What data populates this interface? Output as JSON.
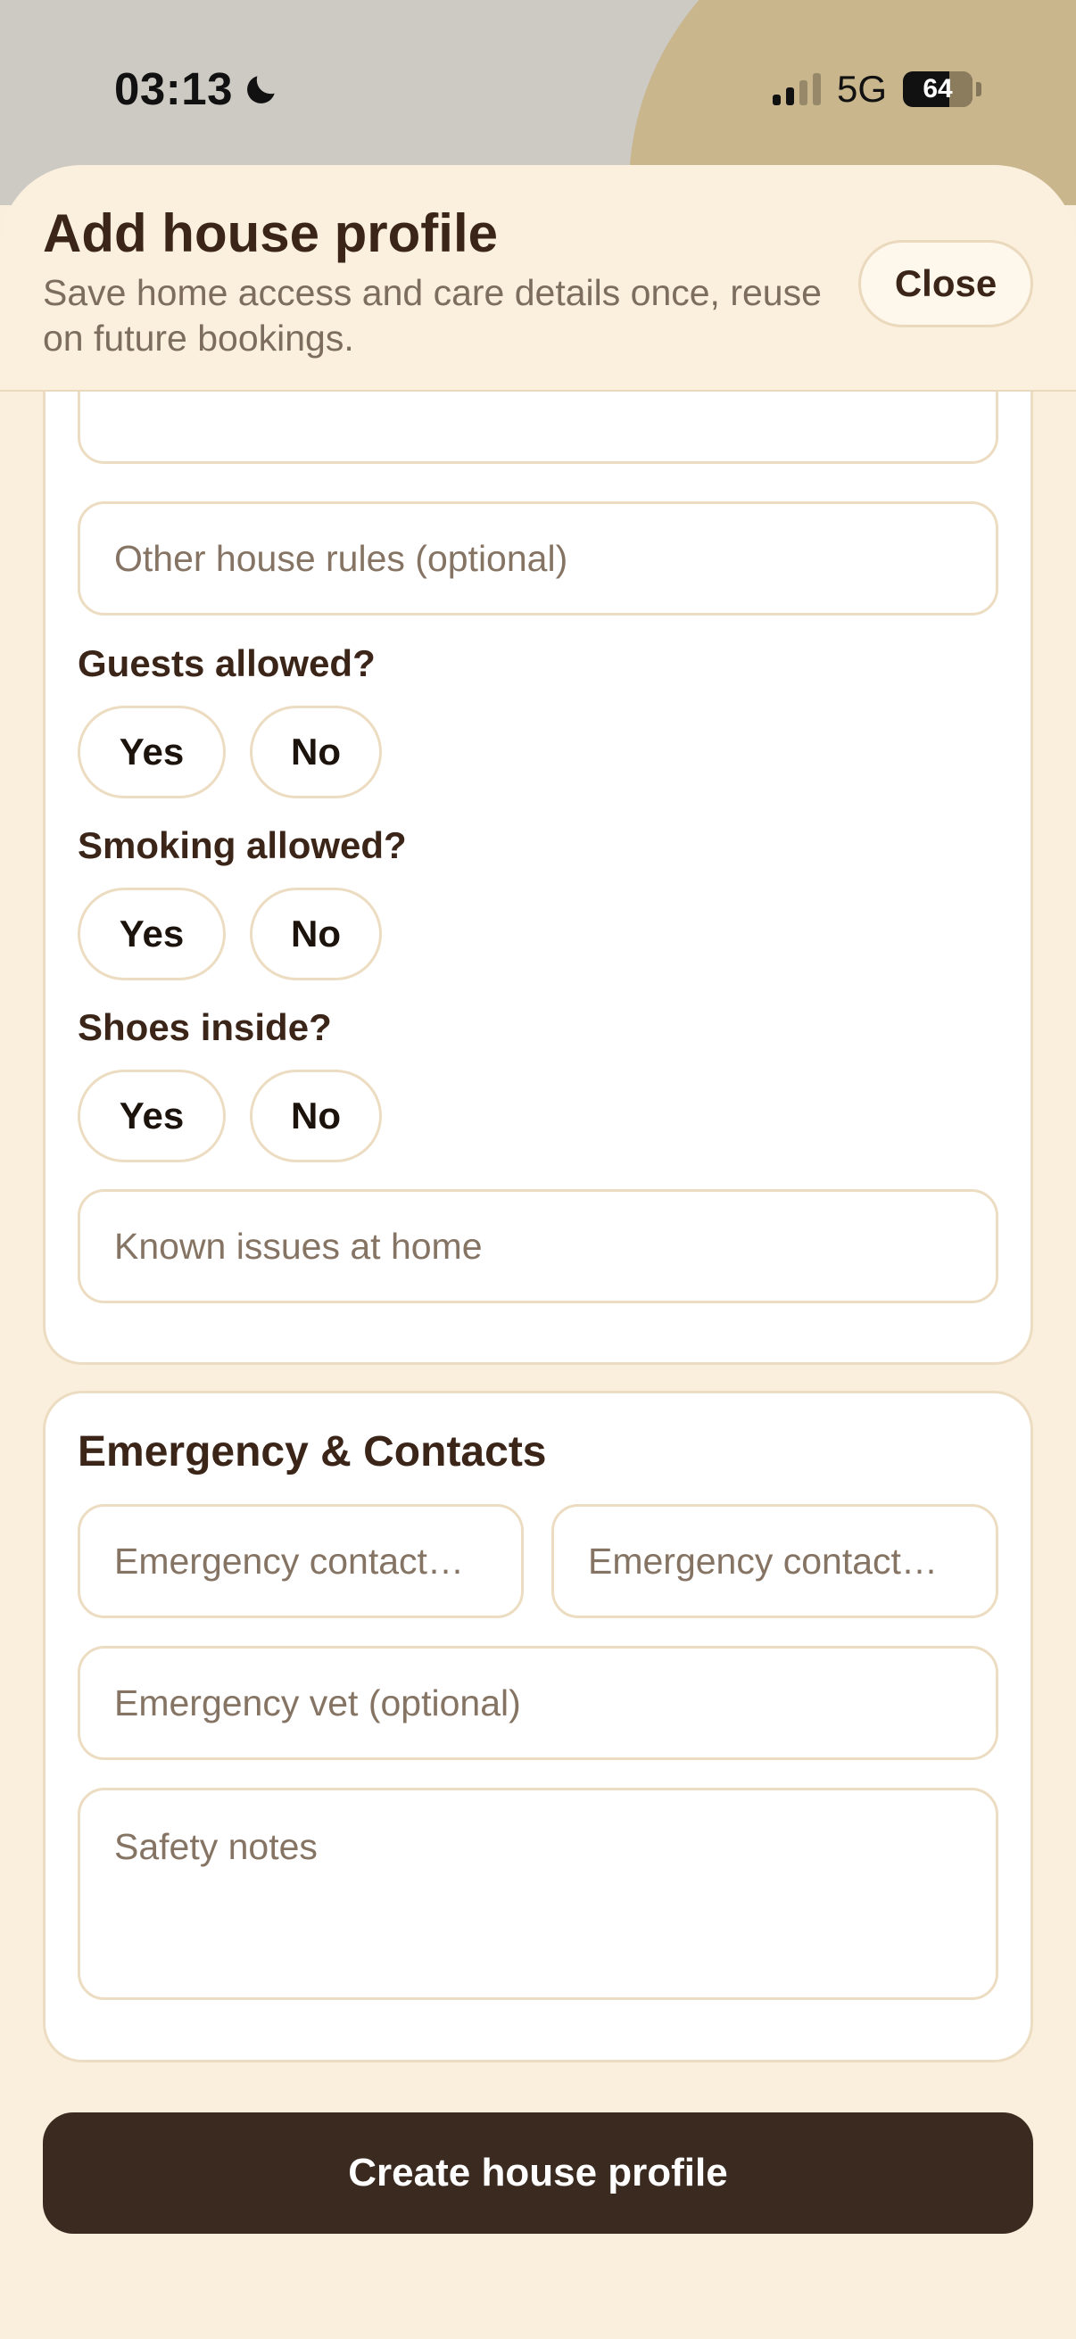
{
  "status_bar": {
    "time": "03:13",
    "network": "5G",
    "battery": "64"
  },
  "sheet": {
    "title": "Add house profile",
    "subtitle": "Save home access and care details once, reuse on future bookings.",
    "close_label": "Close"
  },
  "house_rules": {
    "other_rules_placeholder": "Other house rules (optional)",
    "questions": [
      {
        "label": "Guests allowed?",
        "yes": "Yes",
        "no": "No"
      },
      {
        "label": "Smoking allowed?",
        "yes": "Yes",
        "no": "No"
      },
      {
        "label": "Shoes inside?",
        "yes": "Yes",
        "no": "No"
      }
    ],
    "known_issues_placeholder": "Known issues at home"
  },
  "emergency": {
    "title": "Emergency & Contacts",
    "contact_name_placeholder": "Emergency contact…",
    "contact_phone_placeholder": "Emergency contact…",
    "vet_placeholder": "Emergency vet (optional)",
    "safety_notes_placeholder": "Safety notes"
  },
  "actions": {
    "create_label": "Create house profile"
  },
  "colors": {
    "background": "#f9efdc",
    "title_text": "#3b2518",
    "primary_button": "#3b2a20",
    "border": "#ecdcc1",
    "accent_circle": "#c9b68d"
  }
}
